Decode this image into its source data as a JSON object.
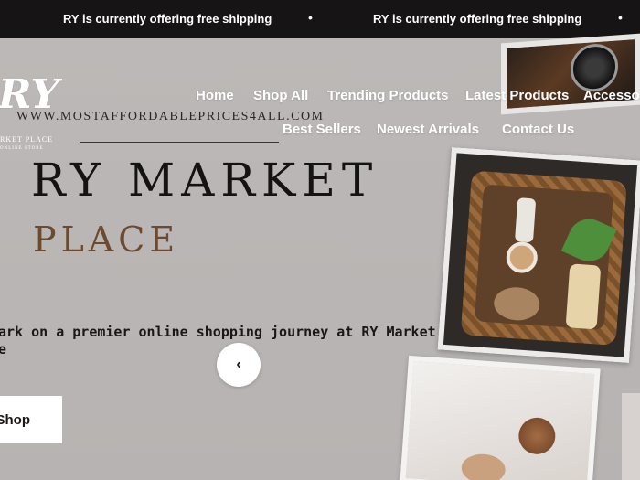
{
  "announcement": {
    "message": "RY is currently offering free shipping",
    "separator": "•"
  },
  "logo": {
    "mark": "RY",
    "subtitle_1": "RKET PLACE",
    "subtitle_2": "ONLINE STORE"
  },
  "website_url": "WWW.MOSTAFFORDABLEPRICES4ALL.COM",
  "nav": {
    "items": [
      {
        "label": "Home"
      },
      {
        "label": "Shop All"
      },
      {
        "label": "Trending Products"
      },
      {
        "label": "Latest Products"
      },
      {
        "label": "Accessor"
      },
      {
        "label": "Best Sellers"
      },
      {
        "label": "Newest Arrivals"
      },
      {
        "label": "Contact Us"
      }
    ]
  },
  "hero": {
    "title_line1": "RY MARKET",
    "title_line2": "PLACE",
    "tagline_line1": "ark on a premier online shopping journey at RY Market",
    "tagline_line2": "e",
    "carousel_prev_icon": "chevron-left-icon",
    "cta_label": "Shop"
  },
  "colors": {
    "announcement_bg": "#161414",
    "hero_bg": "#b8b4b3",
    "title_dark": "#141212",
    "title_brown": "#6b4a30",
    "button_bg": "#ffffff"
  }
}
